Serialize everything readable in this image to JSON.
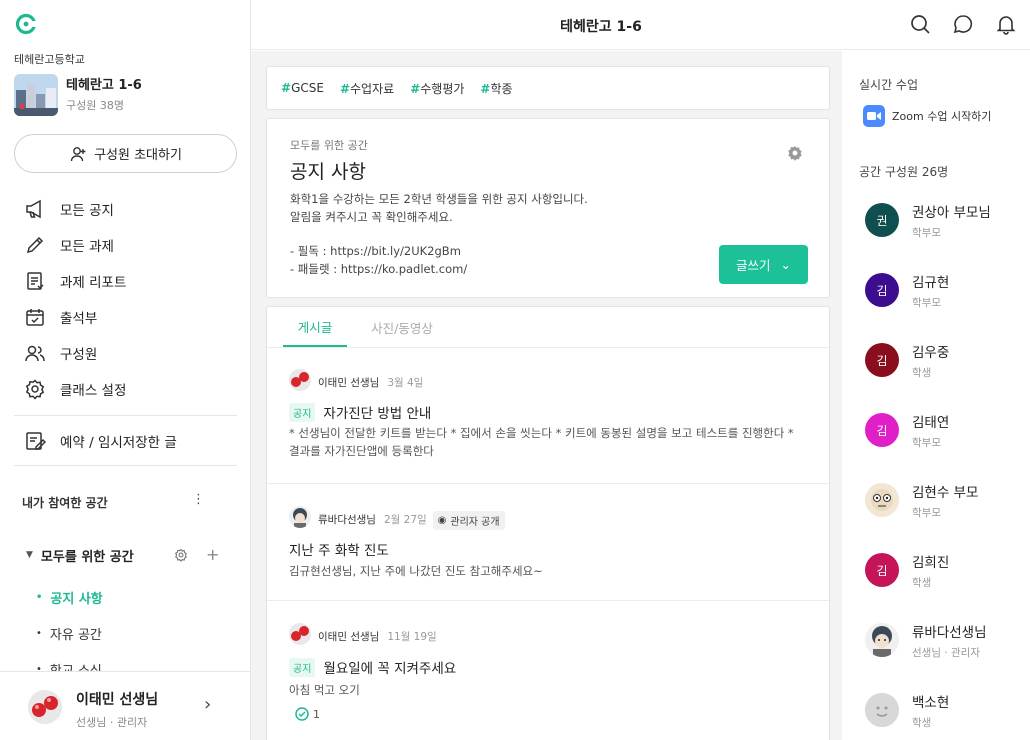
{
  "header": {
    "title": "테헤란고 1-6"
  },
  "sidebar": {
    "school": "테헤란고등학교",
    "class_title": "테헤란고 1-6",
    "class_members": "구성원 38명",
    "invite_label": "구성원 초대하기",
    "nav": [
      {
        "label": "모든 공지",
        "icon": "megaphone-icon"
      },
      {
        "label": "모든 과제",
        "icon": "pencil-icon"
      },
      {
        "label": "과제 리포트",
        "icon": "report-icon"
      },
      {
        "label": "출석부",
        "icon": "calendar-check-icon"
      },
      {
        "label": "구성원",
        "icon": "members-icon"
      },
      {
        "label": "클래스 설정",
        "icon": "gear-icon"
      }
    ],
    "reserved_label": "예약 / 임시저장한 글",
    "section_title": "내가 참여한 공간",
    "group_label": "모두를 위한 공간",
    "sub_items": [
      "공지 사항",
      "자유 공간",
      "학교 소식"
    ],
    "user_name": "이태민 선생님",
    "user_role": "선생님 · 관리자"
  },
  "main": {
    "tags": [
      "GCSE",
      "수업자료",
      "수행평가",
      "학종"
    ],
    "space_sub": "모두를 위한 공간",
    "space_title": "공지 사항",
    "desc_line1": "화학1을 수강하는 모든 2학년 학생들을 위한 공지 사항입니다.",
    "desc_line2": "알림을 켜주시고 꼭 확인해주세요.",
    "link_line1": "- 필독 : https://bit.ly/2UK2gBm",
    "link_line2": "- 패들렛 : https://ko.padlet.com/",
    "write_label": "글쓰기",
    "tabs": [
      "게시글",
      "사진/동영상"
    ],
    "posts": [
      {
        "author": "이태민 선생님",
        "date": "3월 4일",
        "tag": "공지",
        "title": "자가진단 방법 안내",
        "body": "* 선생님이 전달한 키트를 받는다 * 집에서 손을 씻는다 * 키트에 동봉된 설명을 보고 테스트를 진행한다 * 결과를 자가진단앱에 등록한다"
      },
      {
        "author": "류바다선생님",
        "date": "2월 27일",
        "badge": "관리자 공개",
        "title": "지난 주 화학 진도",
        "body": "김규현선생님, 지난 주에 나갔던 진도 참고해주세요~"
      },
      {
        "author": "이태민 선생님",
        "date": "11월 19일",
        "tag": "공지",
        "title": "월요일에 꼭 지켜주세요",
        "body": "아침 먹고 오기",
        "check_count": "1"
      }
    ]
  },
  "right": {
    "live_title": "실시간 수업",
    "zoom_label": "Zoom 수업 시작하기",
    "members_title": "공간 구성원 26명",
    "members": [
      {
        "initial": "권",
        "name": "권상아 부모님",
        "role": "학부모",
        "color": "#0f4f4f"
      },
      {
        "initial": "김",
        "name": "김규현",
        "role": "학부모",
        "color": "#3d0d8f"
      },
      {
        "initial": "김",
        "name": "김우중",
        "role": "학생",
        "color": "#8a0e1d"
      },
      {
        "initial": "김",
        "name": "김태연",
        "role": "학부모",
        "color": "#e01fc7"
      },
      {
        "initial": "",
        "name": "김현수 부모",
        "role": "학부모",
        "color": "#f2e6d4"
      },
      {
        "initial": "김",
        "name": "김희진",
        "role": "학생",
        "color": "#c4155a"
      },
      {
        "initial": "",
        "name": "류바다선생님",
        "role": "선생님 · 관리자",
        "color": "#f0f0f0"
      },
      {
        "initial": "",
        "name": "백소현",
        "role": "학생",
        "color": "#d8d8d8"
      }
    ]
  },
  "colors": {
    "accent": "#1fb893",
    "write_button": "#1cc198",
    "zoom": "#4a8cff"
  }
}
